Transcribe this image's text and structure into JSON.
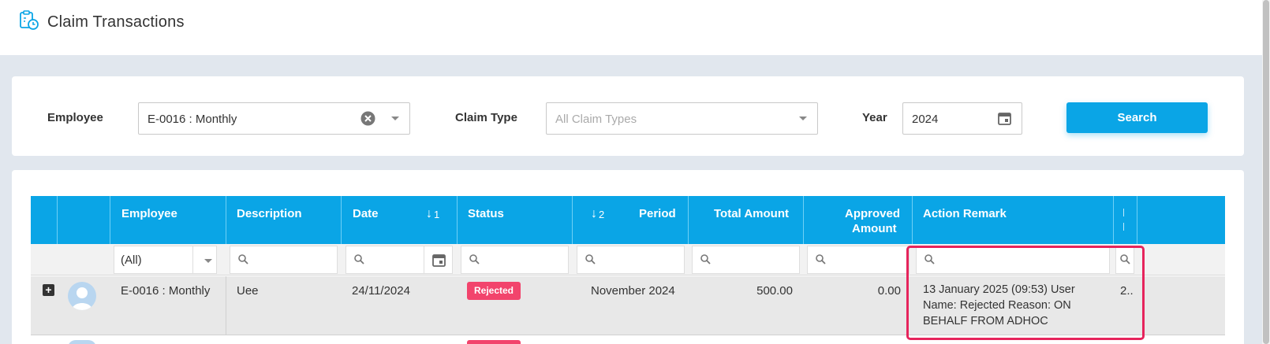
{
  "header": {
    "title": "Claim Transactions",
    "icon": "clipboard-clock-icon"
  },
  "filters": {
    "employee_label": "Employee",
    "employee_value": "E-0016 : Monthly",
    "claim_type_label": "Claim Type",
    "claim_type_placeholder": "All Claim Types",
    "year_label": "Year",
    "year_value": "2024",
    "search_label": "Search"
  },
  "grid": {
    "columns": {
      "employee": "Employee",
      "description": "Description",
      "date": "Date",
      "date_sort": "1",
      "status": "Status",
      "period_sort": "2",
      "period": "Period",
      "total_amount": "Total Amount",
      "approved_amount_line1": "Approved",
      "approved_amount_line2": "Amount",
      "action_remark": "Action Remark"
    },
    "filter_row": {
      "employee_value": "(All)"
    },
    "rows": [
      {
        "employee": "E-0016 : Monthly",
        "description": "Uee",
        "date": "24/11/2024",
        "status": "Rejected",
        "period": "November 2024",
        "total_amount": "500.00",
        "approved_amount": "0.00",
        "action_remark": "13 January 2025 (09:53) User Name: Rejected Reason: ON BEHALF FROM ADHOC",
        "extra": "2.."
      }
    ]
  },
  "colors": {
    "accent": "#0aa5e6",
    "rejected": "#f2446c",
    "highlight": "#e6245c"
  }
}
